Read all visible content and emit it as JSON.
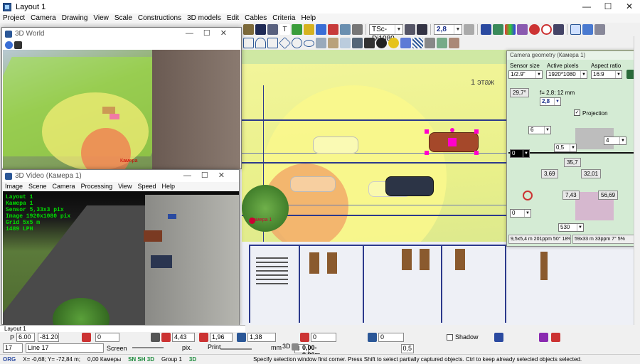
{
  "window": {
    "title": "Layout 1"
  },
  "menu": [
    "Project",
    "Camera",
    "Drawing",
    "View",
    "Scale",
    "Constructions",
    "3D models",
    "Edit",
    "Cables",
    "Criteria",
    "Help"
  ],
  "toolbar": {
    "camera_model": "TSc-Di1080",
    "focal_value": "2,8",
    "camera_select": "Камера 1"
  },
  "world_window": {
    "title": "3D World",
    "label_camera": "Камера"
  },
  "video_window": {
    "title": "3D Video (Камера 1)",
    "menu": [
      "Image",
      "Scene",
      "Camera",
      "Processing",
      "View",
      "Speed",
      "Help"
    ],
    "overlay": [
      "Layout 1",
      "Камера 1",
      "Sensor 5,33x3 pix",
      "Image 1920x1080 pix",
      "Grid 5x5 m",
      "1489 LPH"
    ]
  },
  "plan": {
    "floor_label": "1 этаж",
    "camera_label": "Камера 1"
  },
  "geometry": {
    "title": "Camera geometry (Камера 1)",
    "sensor_size_label": "Sensor size",
    "sensor_size": "1/2.9\"",
    "active_pixels_label": "Active pixels",
    "active_pixels": "1920*1080",
    "aspect_ratio_label": "Aspect ratio",
    "aspect_ratio": "16:9",
    "angle": "29,7°",
    "focal": "f= 2,8; 12 mm",
    "focal_value": "2,8",
    "projection_label": "Projection",
    "height": "6",
    "val_0": "0",
    "val_0_5": "0,5",
    "val_4": "4",
    "val_35_7": "35,7",
    "val_3_69": "3,69",
    "val_32_01": "32,01",
    "val_7_43": "7,43",
    "val_56_69": "56,69",
    "val_tilt": "0",
    "val_530": "530",
    "summary_1": "9,5x5,4 m 201ppm 50° 18%",
    "summary_2": "59x33 m 33ppm 7° 5%"
  },
  "bottom": {
    "tab": "Layout 1",
    "p_label": "P",
    "p_x": "6.00",
    "p_y": "-81.20",
    "val0": "0",
    "w1": "4,43",
    "w2": "1,96",
    "w3": "1,38",
    "c1": "0",
    "c2": "0",
    "shadow_label": "Shadow",
    "layer_num": "17",
    "layer_name": "Line 17",
    "screen_label": "Screen",
    "screen_val": "3",
    "pix_label": "pix.",
    "print_label": "Print",
    "print_val": "0,5",
    "mm_label": "mm",
    "d3_label": "3D",
    "coords_3d": "0,00-0,00m"
  },
  "status": {
    "org": "ORG",
    "xy": "X= -0,68; Y= -72,84 m;",
    "cams": "0,00 Камеры",
    "flags": "SN SH 3D",
    "group": "Group 1",
    "group3d": "3D",
    "message": "Specify selection window first corner. Press Shift to select partially captured objects. Ctrl to keep already selected objects selected."
  },
  "colors": {
    "accent": "#2c3a8c",
    "green_zone": "#cfe8a3",
    "yellow_zone": "#f2f59a",
    "red_zone": "#f08a6a",
    "overlay_text": "#00e000"
  }
}
